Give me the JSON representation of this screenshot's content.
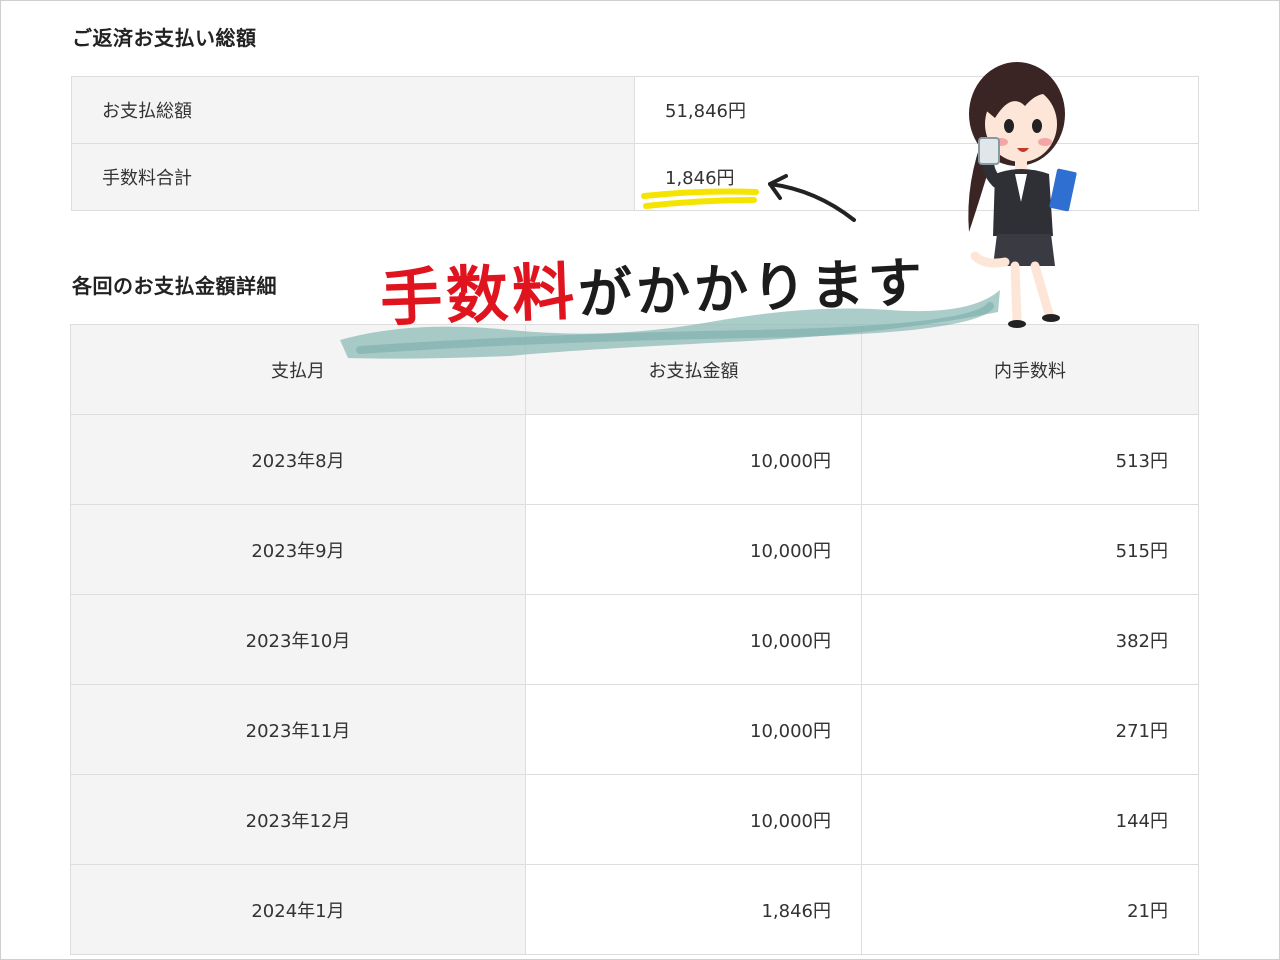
{
  "summary": {
    "heading": "ご返済お支払い総額",
    "rows": [
      {
        "label": "お支払総額",
        "value": "51,846円"
      },
      {
        "label": "手数料合計",
        "value": "1,846円"
      }
    ]
  },
  "detail": {
    "heading": "各回のお支払金額詳細",
    "columns": [
      "支払月",
      "お支払金額",
      "内手数料"
    ],
    "rows": [
      {
        "month": "2023年8月",
        "amount": "10,000円",
        "fee": "513円"
      },
      {
        "month": "2023年9月",
        "amount": "10,000円",
        "fee": "515円"
      },
      {
        "month": "2023年10月",
        "amount": "10,000円",
        "fee": "382円"
      },
      {
        "month": "2023年11月",
        "amount": "10,000円",
        "fee": "271円"
      },
      {
        "month": "2023年12月",
        "amount": "10,000円",
        "fee": "144円"
      },
      {
        "month": "2024年1月",
        "amount": "1,846円",
        "fee": "21円"
      }
    ]
  },
  "annotation": {
    "text_red": "手数料",
    "text_black": "がかかります",
    "colors": {
      "red": "#e0141f",
      "brush": "#8fbcb8",
      "highlight": "#f5e400"
    }
  }
}
